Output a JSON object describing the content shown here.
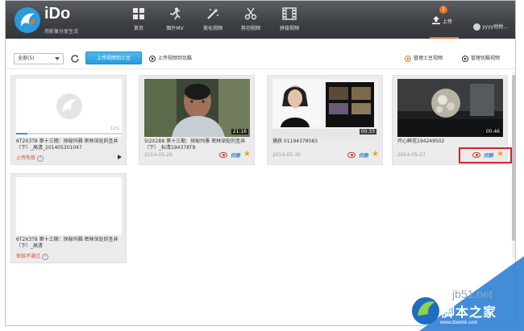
{
  "header": {
    "brand": "iDo",
    "slogan": "用影像分享生活",
    "nav": [
      {
        "icon": "home-grid-icon",
        "label": "首页"
      },
      {
        "icon": "dancer-icon",
        "label": "图片MV"
      },
      {
        "icon": "magic-wand-icon",
        "label": "美化视频"
      },
      {
        "icon": "scissors-icon",
        "label": "剪切视频"
      },
      {
        "icon": "film-strip-icon",
        "label": "拼接视频"
      }
    ],
    "upload_label": "上传",
    "upload_badge": "1",
    "user_name": "yyyy他他...",
    "accent": "#e8742a"
  },
  "toolbar": {
    "filter_value": "全部(5)",
    "upload_tudou_button": "上传视频到土豆",
    "upload_youku_link": "上传视频到优酷",
    "manage_tudou_link": "管理土豆视频",
    "manage_youku_link": "管理优酷视频",
    "button_color": "#2a9bdc"
  },
  "cards": [
    {
      "title": "6T2X3T8 第十三期：探秘玛雅 密林深处的圣井（下）_高清_201405301047",
      "status": "上传失败",
      "progress_text": "11%",
      "progress": 0.11
    },
    {
      "title": "5I2X2B8 第十三期：探秘玛雅 密林深处的圣井（下）_标清194378T8",
      "duration": "21:16",
      "date": "2014-05-29"
    },
    {
      "title": "捕获 01194378583",
      "duration": "00:33",
      "date": "2014-05-30"
    },
    {
      "title": "开心鲜花194249502",
      "duration": "00:46",
      "date": "2014-05-27"
    },
    {
      "title": "6T2X3T8 第十三期：探秘玛雅 密林深处的圣井（下）_高清",
      "status": "审核不通过"
    }
  ],
  "actions": {
    "youku_label": "优酷"
  },
  "watermark": {
    "url": "jb51.net",
    "name": "脚本之家",
    "site": "www.dowmk.com"
  }
}
